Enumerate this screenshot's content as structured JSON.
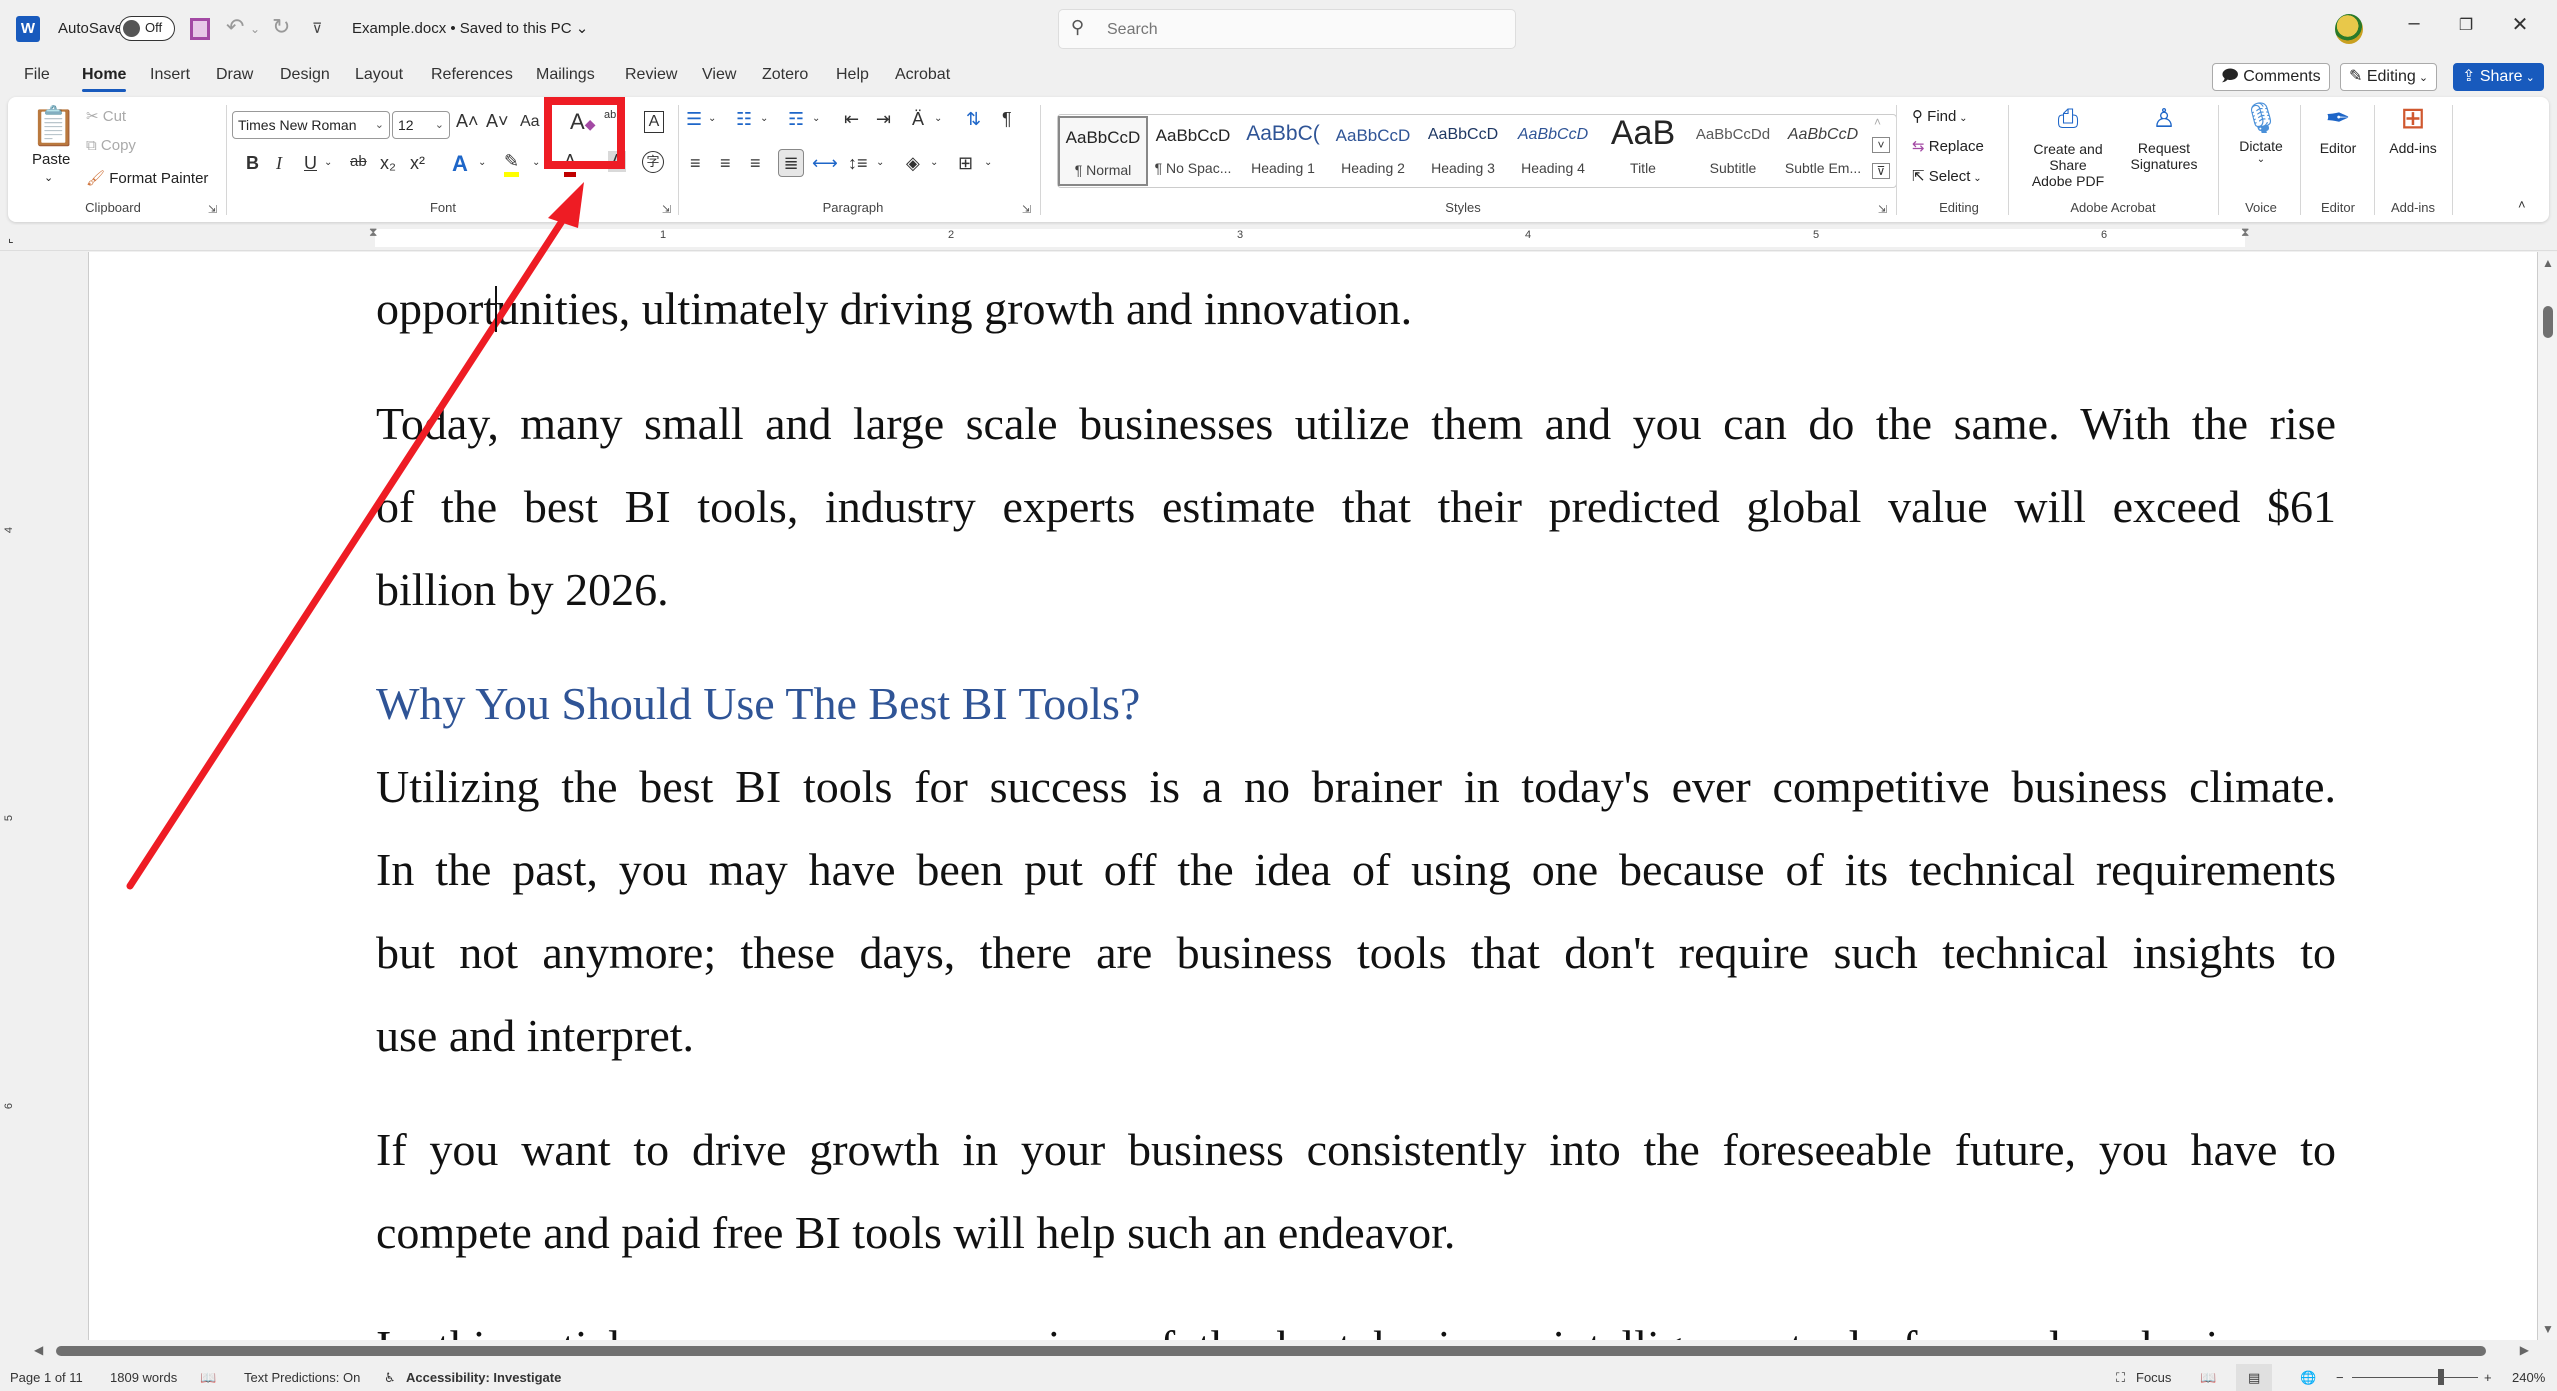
{
  "titlebar": {
    "app_icon": "W",
    "autosave_label": "AutoSave",
    "autosave_state": "Off",
    "document_title": "Example.docx • Saved to this PC ⌄",
    "search_placeholder": "Search",
    "minimize": "–",
    "restore": "❐",
    "close": "✕"
  },
  "tabs": [
    {
      "label": "File"
    },
    {
      "label": "Home"
    },
    {
      "label": "Insert"
    },
    {
      "label": "Draw"
    },
    {
      "label": "Design"
    },
    {
      "label": "Layout"
    },
    {
      "label": "References"
    },
    {
      "label": "Mailings"
    },
    {
      "label": "Review"
    },
    {
      "label": "View"
    },
    {
      "label": "Zotero"
    },
    {
      "label": "Help"
    },
    {
      "label": "Acrobat"
    }
  ],
  "active_tab": "Home",
  "actions": {
    "comments": "Comments",
    "editing": "Editing",
    "share": "Share"
  },
  "ribbon": {
    "clipboard": {
      "label": "Clipboard",
      "paste": "Paste",
      "cut": "Cut",
      "copy": "Copy",
      "format_painter": "Format Painter"
    },
    "font": {
      "label": "Font",
      "font_name": "Times New Roman",
      "font_size": "12",
      "change_case": "Aa"
    },
    "paragraph": {
      "label": "Paragraph"
    },
    "styles": {
      "label": "Styles",
      "items": [
        {
          "sample": "AaBbCcD",
          "name": "¶ Normal"
        },
        {
          "sample": "AaBbCcD",
          "name": "¶ No Spac..."
        },
        {
          "sample": "AaBbC(",
          "name": "Heading 1"
        },
        {
          "sample": "AaBbCcD",
          "name": "Heading 2"
        },
        {
          "sample": "AaBbCcD",
          "name": "Heading 3"
        },
        {
          "sample": "AaBbCcD",
          "name": "Heading 4"
        },
        {
          "sample": "AaB",
          "name": "Title"
        },
        {
          "sample": "AaBbCcDd",
          "name": "Subtitle"
        },
        {
          "sample": "AaBbCcD",
          "name": "Subtle Em..."
        }
      ]
    },
    "editing": {
      "label": "Editing",
      "find": "Find",
      "replace": "Replace",
      "select": "Select"
    },
    "acrobat": {
      "label": "Adobe Acrobat",
      "create_share_1": "Create and Share",
      "create_share_2": "Adobe PDF",
      "request_1": "Request",
      "request_2": "Signatures"
    },
    "voice": {
      "label": "Voice",
      "dictate": "Dictate"
    },
    "editor": {
      "label": "Editor",
      "editor": "Editor"
    },
    "addins": {
      "label": "Add-ins",
      "addins": "Add-ins"
    }
  },
  "ruler": {
    "marks": [
      "1",
      "2",
      "3",
      "4",
      "5",
      "6"
    ],
    "vmarks": [
      "4",
      "5",
      "6"
    ]
  },
  "document": {
    "lines": [
      {
        "text": "opportunities, ultimately driving growth and innovation.",
        "style": "body"
      },
      {
        "text": "Today, many small and large scale businesses utilize them and you can do the same. With the rise",
        "style": "body-just"
      },
      {
        "text": "of the best BI tools, industry experts estimate that their predicted global value will exceed $61",
        "style": "body-just"
      },
      {
        "text": "billion by 2026.",
        "style": "body"
      },
      {
        "text": "Why You Should Use The Best BI Tools?",
        "style": "heading"
      },
      {
        "text": "Utilizing the best BI tools for success is a no brainer in today's ever competitive business climate.",
        "style": "body-just"
      },
      {
        "text": "In the past, you may have been put off the idea of using one because of its technical requirements",
        "style": "body-just"
      },
      {
        "text": "but not anymore; these days, there are business tools that don't require such technical insights to",
        "style": "body-just"
      },
      {
        "text": "use and interpret.",
        "style": "body"
      },
      {
        "text": "If you want to drive growth in your business consistently into the foreseeable future, you have to",
        "style": "body-just"
      },
      {
        "text": "compete and paid free BI tools will help such an endeavor.",
        "style": "body"
      },
      {
        "text": "In this article, we cover an overview of the best business intelligence tools for modern businesses",
        "style": "body-just"
      }
    ]
  },
  "status": {
    "page": "Page 1 of 11",
    "words": "1809 words",
    "text_predictions": "Text Predictions: On",
    "accessibility": "Accessibility: Investigate",
    "focus": "Focus",
    "zoom_level": "240%",
    "zoom_percent": 240
  },
  "annotation": {
    "color": "#ee1c24",
    "target": "clear-all-formatting-button"
  },
  "colors": {
    "accent": "#185abd",
    "heading": "#2f5496"
  }
}
